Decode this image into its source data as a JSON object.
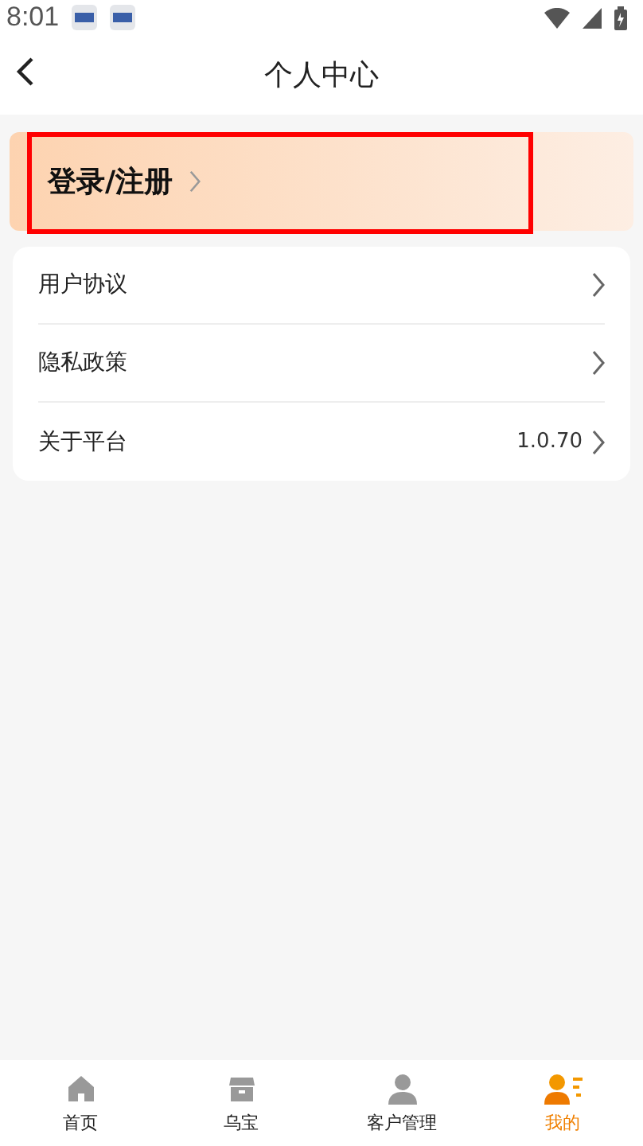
{
  "status_bar": {
    "time": "8:01"
  },
  "header": {
    "title": "个人中心"
  },
  "login": {
    "label": "登录/注册",
    "highlighted": true
  },
  "menu": [
    {
      "label": "用户协议"
    },
    {
      "label": "隐私政策"
    },
    {
      "label": "关于平台",
      "value": "1.0.70"
    }
  ],
  "tabs": [
    {
      "label": "首页",
      "kind": "home",
      "selected": false
    },
    {
      "label": "乌宝",
      "kind": "shop",
      "selected": false
    },
    {
      "label": "客户管理",
      "kind": "person",
      "selected": false
    },
    {
      "label": "我的",
      "kind": "profile",
      "selected": true
    }
  ]
}
